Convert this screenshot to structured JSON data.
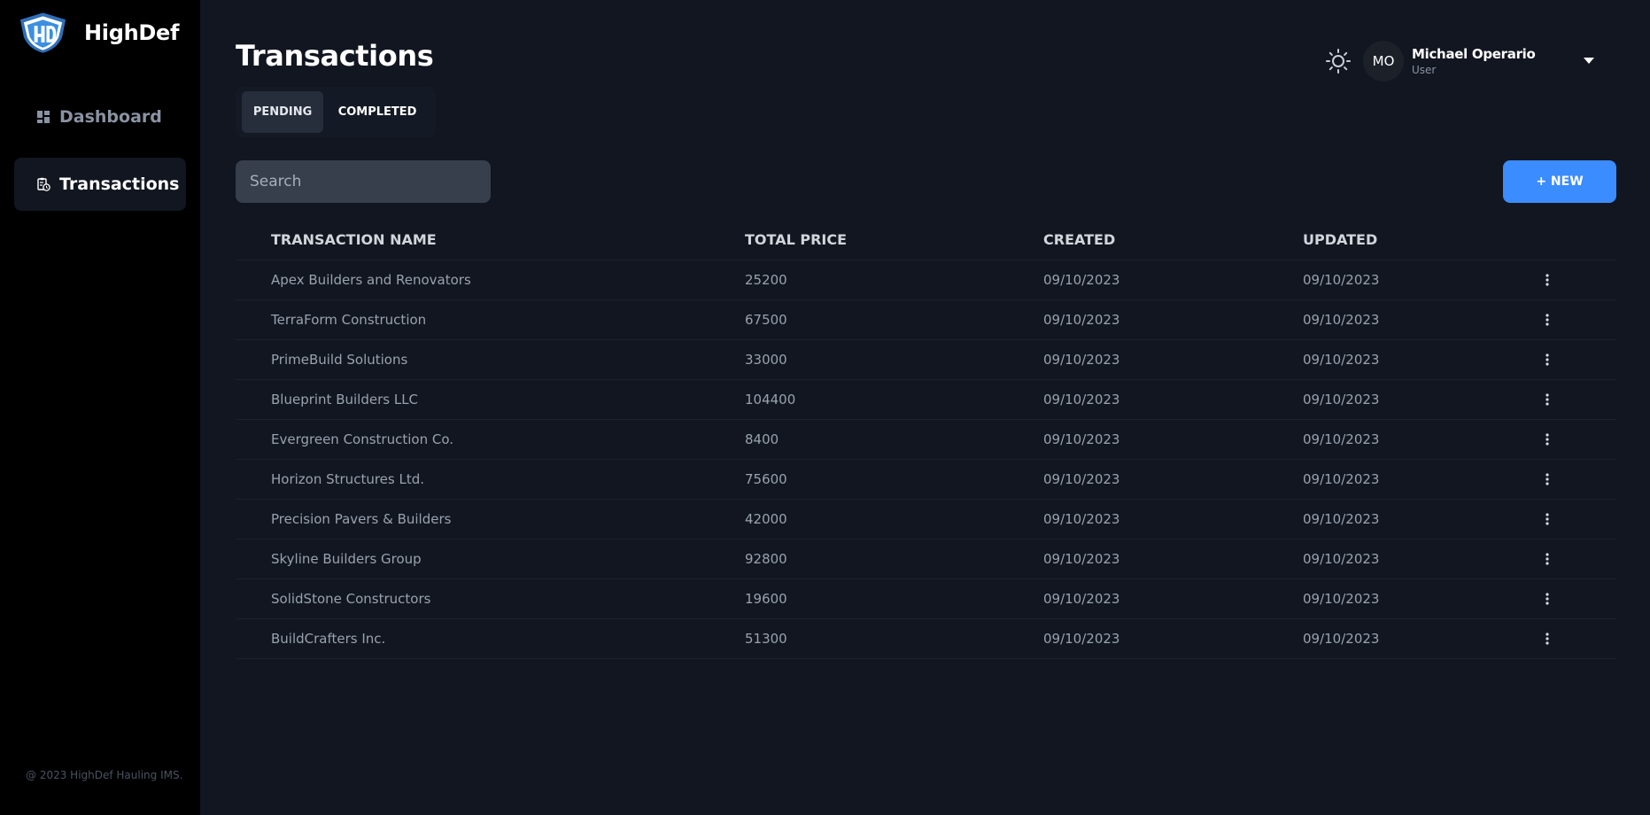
{
  "brand": {
    "name": "HighDef",
    "logo_letters": "HD",
    "logo_color": "#3b8fe0"
  },
  "sidebar": {
    "items": [
      {
        "label": "Dashboard",
        "icon": "dashboard-grid-icon",
        "active": false
      },
      {
        "label": "Transactions",
        "icon": "clipboard-clock-icon",
        "active": true
      }
    ],
    "footer": "@ 2023 HighDef Hauling IMS."
  },
  "header": {
    "title": "Transactions",
    "theme_icon": "sun-icon",
    "user": {
      "initials": "MO",
      "name": "Michael Operario",
      "role": "User"
    }
  },
  "tabs": [
    {
      "label": "PENDING",
      "active": true
    },
    {
      "label": "COMPLETED",
      "active": false
    }
  ],
  "search": {
    "placeholder": "Search",
    "value": ""
  },
  "new_button": {
    "label": "+ NEW",
    "color": "#3b8cff"
  },
  "table": {
    "columns": [
      "TRANSACTION NAME",
      "TOTAL PRICE",
      "CREATED",
      "UPDATED"
    ],
    "rows": [
      {
        "name": "Apex Builders and Renovators",
        "price": "25200",
        "created": "09/10/2023",
        "updated": "09/10/2023"
      },
      {
        "name": "TerraForm Construction",
        "price": "67500",
        "created": "09/10/2023",
        "updated": "09/10/2023"
      },
      {
        "name": "PrimeBuild Solutions",
        "price": "33000",
        "created": "09/10/2023",
        "updated": "09/10/2023"
      },
      {
        "name": "Blueprint Builders LLC",
        "price": "104400",
        "created": "09/10/2023",
        "updated": "09/10/2023"
      },
      {
        "name": "Evergreen Construction Co.",
        "price": "8400",
        "created": "09/10/2023",
        "updated": "09/10/2023"
      },
      {
        "name": "Horizon Structures Ltd.",
        "price": "75600",
        "created": "09/10/2023",
        "updated": "09/10/2023"
      },
      {
        "name": "Precision Pavers & Builders",
        "price": "42000",
        "created": "09/10/2023",
        "updated": "09/10/2023"
      },
      {
        "name": "Skyline Builders Group",
        "price": "92800",
        "created": "09/10/2023",
        "updated": "09/10/2023"
      },
      {
        "name": "SolidStone Constructors",
        "price": "19600",
        "created": "09/10/2023",
        "updated": "09/10/2023"
      },
      {
        "name": "BuildCrafters Inc.",
        "price": "51300",
        "created": "09/10/2023",
        "updated": "09/10/2023"
      }
    ]
  }
}
